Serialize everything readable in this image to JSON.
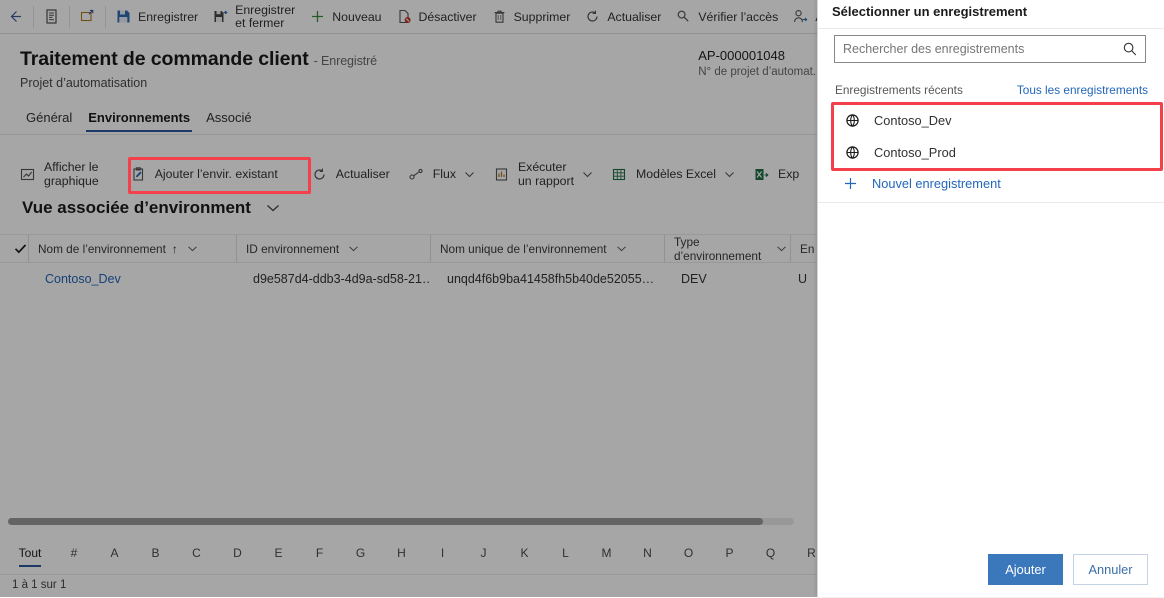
{
  "toolbar": {
    "items": [
      {
        "name": "back",
        "icon": "back-arrow-icon",
        "label": ""
      },
      {
        "name": "form-selector",
        "icon": "form-icon",
        "label": ""
      },
      {
        "name": "popout",
        "icon": "popout-icon",
        "label": ""
      },
      {
        "name": "save",
        "icon": "save-icon",
        "label": "Enregistrer"
      },
      {
        "name": "save-and-close",
        "icon": "save-close-icon",
        "label": "Enregistrer",
        "label2": "et fermer"
      },
      {
        "name": "new",
        "icon": "plus-icon",
        "label": "Nouveau"
      },
      {
        "name": "deactivate",
        "icon": "deactivate-icon",
        "label": "Désactiver"
      },
      {
        "name": "delete",
        "icon": "trash-icon",
        "label": "Supprimer"
      },
      {
        "name": "refresh",
        "icon": "refresh-icon",
        "label": "Actualiser"
      },
      {
        "name": "check-access",
        "icon": "key-icon",
        "label": "Vérifier l’accès"
      },
      {
        "name": "assign",
        "icon": "assign-user-icon",
        "label": "Affecter"
      },
      {
        "name": "share",
        "icon": "share-icon",
        "label": ""
      }
    ]
  },
  "header": {
    "title": "Traitement de commande client",
    "status": "- Enregistré",
    "entity": "Projet d’automatisation",
    "record_number": "AP-000001048",
    "record_number_label": "N° de projet d’automat.",
    "tabs": [
      {
        "label": "Général",
        "selected": false
      },
      {
        "label": "Environnements",
        "selected": true
      },
      {
        "label": "Associé",
        "selected": false
      }
    ]
  },
  "commandbar": {
    "items": [
      {
        "name": "show-chart",
        "icon": "chart-icon",
        "label": "Afficher le",
        "label2": "graphique",
        "chevron": false
      },
      {
        "name": "add-existing-environment",
        "icon": "add-existing-icon",
        "label": "Ajouter l’envir. existant",
        "chevron": false,
        "highlighted": true
      },
      {
        "name": "refresh",
        "icon": "refresh-icon",
        "label": "Actualiser",
        "chevron": false
      },
      {
        "name": "flow",
        "icon": "flow-icon",
        "label": "Flux",
        "chevron": true
      },
      {
        "name": "run-report",
        "icon": "report-icon",
        "label": "Exécuter",
        "label2": "un rapport",
        "chevron": true
      },
      {
        "name": "excel-templates",
        "icon": "excel-icon",
        "label": "Modèles Excel",
        "chevron": true
      },
      {
        "name": "export",
        "icon": "export-excel-icon",
        "label": "Exp",
        "chevron": false
      }
    ]
  },
  "view": {
    "name": "Vue associée d’environment",
    "columns": [
      {
        "label": "Nom de l’environnement",
        "sorted": true,
        "sort_glyph": "↑"
      },
      {
        "label": "ID environnement"
      },
      {
        "label": "Nom unique de l’environnement"
      },
      {
        "label": "Type d’environnement"
      },
      {
        "label": "En"
      }
    ],
    "rows": [
      {
        "name": "Contoso_Dev",
        "id": "d9e587d4-ddb3-4d9a-sd58-21…",
        "unique_name": "unqd4f6b9ba41458fh5b40de52055…",
        "type": "DEV",
        "extra": "U"
      }
    ],
    "alpha_filters": [
      "Tout",
      "#",
      "A",
      "B",
      "C",
      "D",
      "E",
      "F",
      "G",
      "H",
      "I",
      "J",
      "K",
      "L",
      "M",
      "N",
      "O",
      "P",
      "Q",
      "R"
    ],
    "alpha_selected": "Tout",
    "record_count": "1 à 1 sur 1"
  },
  "lookup_panel": {
    "title": "Sélectionner un enregistrement",
    "search_placeholder": "Rechercher des enregistrements",
    "search_value": "",
    "search_icon": "search-icon",
    "recent_label": "Enregistrements récents",
    "all_records_link": "Tous les enregistrements",
    "records": [
      {
        "label": "Contoso_Dev",
        "icon": "globe-icon"
      },
      {
        "label": "Contoso_Prod",
        "icon": "globe-icon"
      }
    ],
    "new_record_label": "Nouvel enregistrement",
    "new_record_icon": "plus-icon",
    "primary_button": "Ajouter",
    "secondary_button": "Annuler"
  },
  "annotations": {
    "accent_red": "#f4404a",
    "boxes": [
      {
        "name": "highlight-add-existing-environment"
      },
      {
        "name": "highlight-recent-records"
      }
    ]
  },
  "colors": {
    "accent_blue": "#2b579a",
    "link_blue": "#2266bb",
    "primary_button": "#3b78bb"
  }
}
